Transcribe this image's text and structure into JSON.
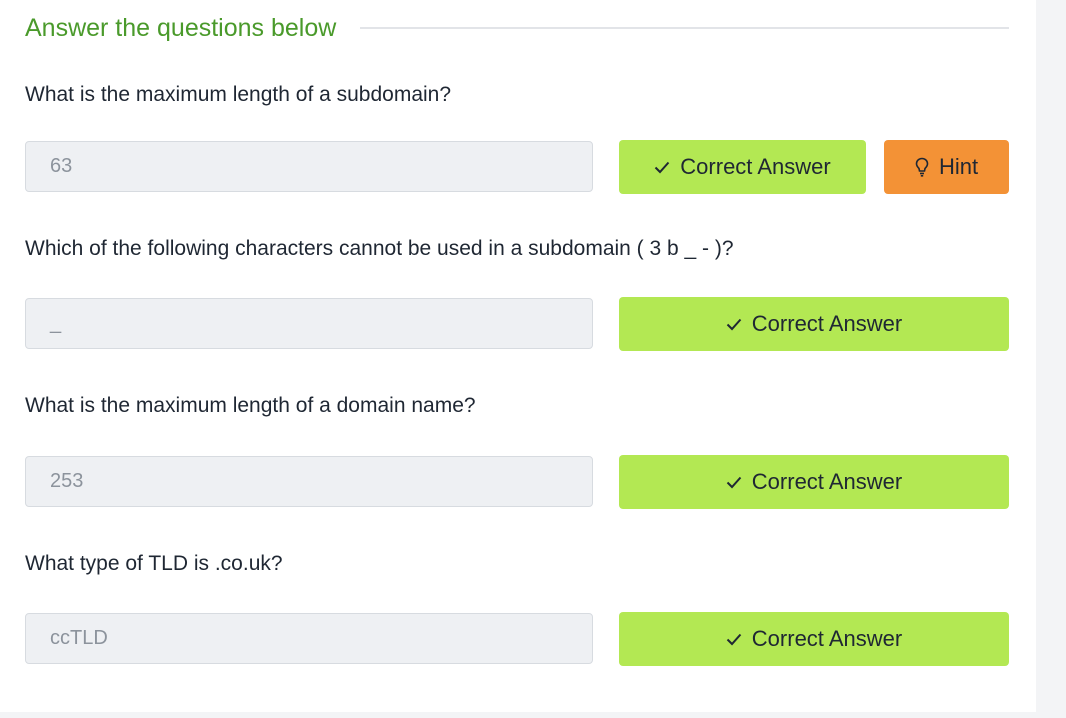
{
  "section": {
    "title": "Answer the questions below"
  },
  "questions": [
    {
      "text": "What is the maximum length of a subdomain?",
      "answer": "63",
      "button_label": "Correct Answer",
      "hint_label": "Hint"
    },
    {
      "text": "Which of the following characters cannot be used in a subdomain ( 3 b _ - )?",
      "answer": "_",
      "button_label": "Correct Answer"
    },
    {
      "text": "What is the maximum length of a domain name?",
      "answer": "253",
      "button_label": "Correct Answer"
    },
    {
      "text": "What type of TLD is .co.uk?",
      "answer": "ccTLD",
      "button_label": "Correct Answer"
    }
  ],
  "icons": {
    "check": "check-icon",
    "hint": "lightbulb-icon"
  },
  "colors": {
    "title_green": "#4a9a2b",
    "correct_button": "#b3e853",
    "hint_button": "#f39236",
    "answer_box_bg": "#eef0f3",
    "answer_text": "#8c939c"
  }
}
